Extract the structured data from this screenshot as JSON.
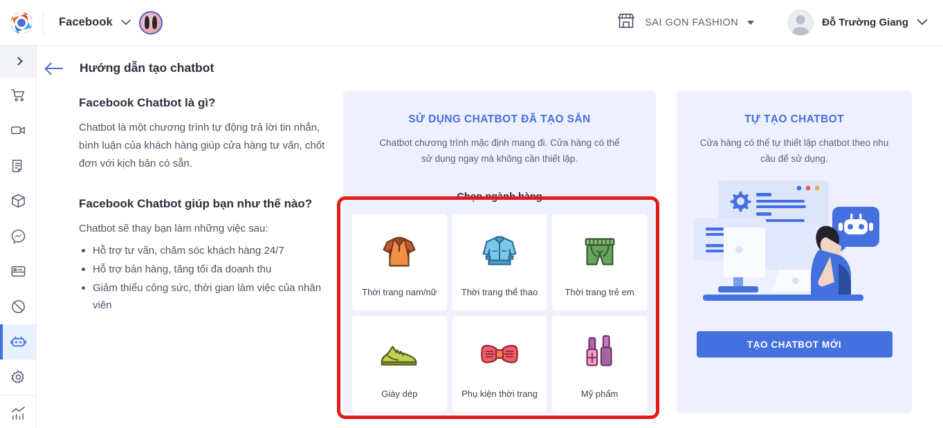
{
  "header": {
    "logo_icon": "shutter-pinwheel-logo",
    "brand_label": "Facebook",
    "brand_dropdown_icon": "chevron-down-icon",
    "page_avatar_icon": "page-avatar",
    "shop_icon": "storefront-icon",
    "shop_name": "SAI GON FASHION",
    "shop_dropdown_icon": "caret-down-icon",
    "user_avatar_icon": "user-avatar",
    "user_name": "Đỗ Trường Giang",
    "user_dropdown_icon": "chevron-down-icon"
  },
  "sidebar": {
    "expand_icon": "chevron-right-icon",
    "items": [
      {
        "name": "cart",
        "icon": "shopping-cart-icon",
        "active": false
      },
      {
        "name": "video",
        "icon": "video-camera-icon",
        "active": false
      },
      {
        "name": "orders",
        "icon": "document-icon",
        "active": false
      },
      {
        "name": "products",
        "icon": "box-icon",
        "active": false
      },
      {
        "name": "messenger",
        "icon": "messenger-icon",
        "active": false
      },
      {
        "name": "cards",
        "icon": "id-card-icon",
        "active": false
      },
      {
        "name": "blocked",
        "icon": "no-entry-icon",
        "active": false
      },
      {
        "name": "chatbot",
        "icon": "robot-icon",
        "active": true
      },
      {
        "name": "settings",
        "icon": "gear-icon",
        "active": false
      },
      {
        "name": "analytics",
        "icon": "bar-chart-icon",
        "active": false
      }
    ]
  },
  "page": {
    "back_icon": "arrow-left-icon",
    "title": "Hướng dẫn tạo chatbot"
  },
  "info": {
    "heading1": "Facebook Chatbot là gì?",
    "paragraph1": "Chatbot là một chương trình tự động trả lời tin nhắn, bình luận của khách hàng giúp cửa hàng tư vấn, chốt đơn với kịch bản có sẵn.",
    "heading2": "Facebook Chatbot giúp bạn như thế nào?",
    "paragraph2": "Chatbot sẽ thay bạn làm những việc sau:",
    "bullets": [
      "Hỗ trợ tư vấn, chăm sóc khách hàng 24/7",
      "Hỗ trợ bán hàng, tăng tối đa doanh thu",
      "Giảm thiểu công sức, thời gian làm việc của nhân viên"
    ]
  },
  "middle_panel": {
    "title": "SỬ DỤNG CHATBOT ĐÃ TẠO SẴN",
    "subtitle": "Chatbot chương trình mặc định mang đi. Cửa hàng có thể sử dụng ngay mà không cần thiết lập.",
    "choose_label": "Chọn ngành hàng",
    "categories": [
      {
        "label": "Thời trang nam/nữ",
        "icon": "polo-shirt-icon"
      },
      {
        "label": "Thời trang thể thao",
        "icon": "jacket-icon"
      },
      {
        "label": "Thời trang trẻ em",
        "icon": "shorts-icon"
      },
      {
        "label": "Giày dép",
        "icon": "sneaker-icon"
      },
      {
        "label": "Phụ kiện thời trang",
        "icon": "bowtie-icon"
      },
      {
        "label": "Mỹ phẩm",
        "icon": "nail-polish-icon"
      }
    ]
  },
  "right_panel": {
    "title": "TỰ TẠO CHATBOT",
    "subtitle": "Cửa hàng có thể tự thiết lập chatbot theo nhu cầu để sử dụng.",
    "illustration_icon": "person-at-desk-chatbot-illustration",
    "cta_label": "TẠO CHATBOT MỚI"
  },
  "annotation": {
    "type": "red-highlight-rectangle",
    "color": "#e21b1b"
  },
  "colors": {
    "accent": "#4470e0",
    "panel_bg": "#eef0fe",
    "annotation": "#e21b1b",
    "text": "#3c4257"
  }
}
